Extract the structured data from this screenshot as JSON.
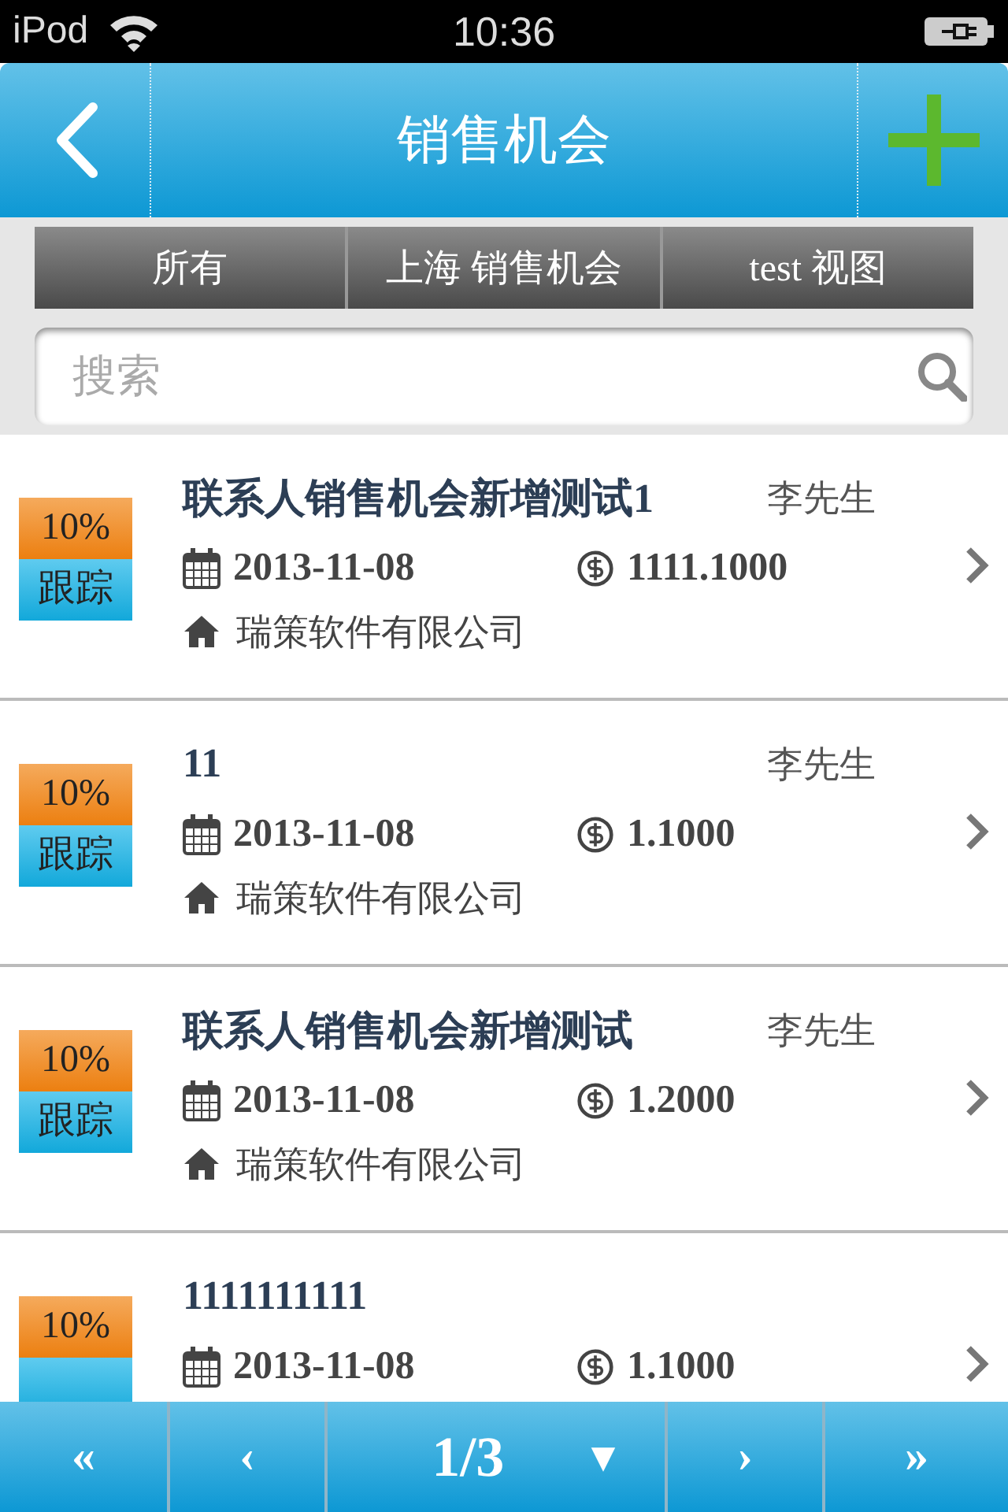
{
  "status_bar": {
    "carrier": "iPod",
    "time": "10:36"
  },
  "header": {
    "title": "销售机会"
  },
  "tabs": [
    {
      "label": "所有",
      "selected": false
    },
    {
      "label": "上海 销售机会",
      "selected": false
    },
    {
      "label": "test 视图",
      "selected": false
    }
  ],
  "search": {
    "placeholder": "搜索"
  },
  "items": [
    {
      "percent": "10%",
      "stage": "跟踪",
      "title": "联系人销售机会新增测试1",
      "contact": "李先生",
      "date": "2013-11-08",
      "amount": "1111.1000",
      "company": "瑞策软件有限公司"
    },
    {
      "percent": "10%",
      "stage": "跟踪",
      "title": "11",
      "contact": "李先生",
      "date": "2013-11-08",
      "amount": "1.1000",
      "company": "瑞策软件有限公司"
    },
    {
      "percent": "10%",
      "stage": "跟踪",
      "title": "联系人销售机会新增测试",
      "contact": "李先生",
      "date": "2013-11-08",
      "amount": "1.2000",
      "company": "瑞策软件有限公司"
    },
    {
      "percent": "10%",
      "title": "1111111111",
      "date": "2013-11-08",
      "amount": "1.1000"
    }
  ],
  "pager": {
    "first": "«",
    "prev": "‹",
    "page": "1/3",
    "dropdown": "▼",
    "next": "›",
    "last": "»"
  }
}
